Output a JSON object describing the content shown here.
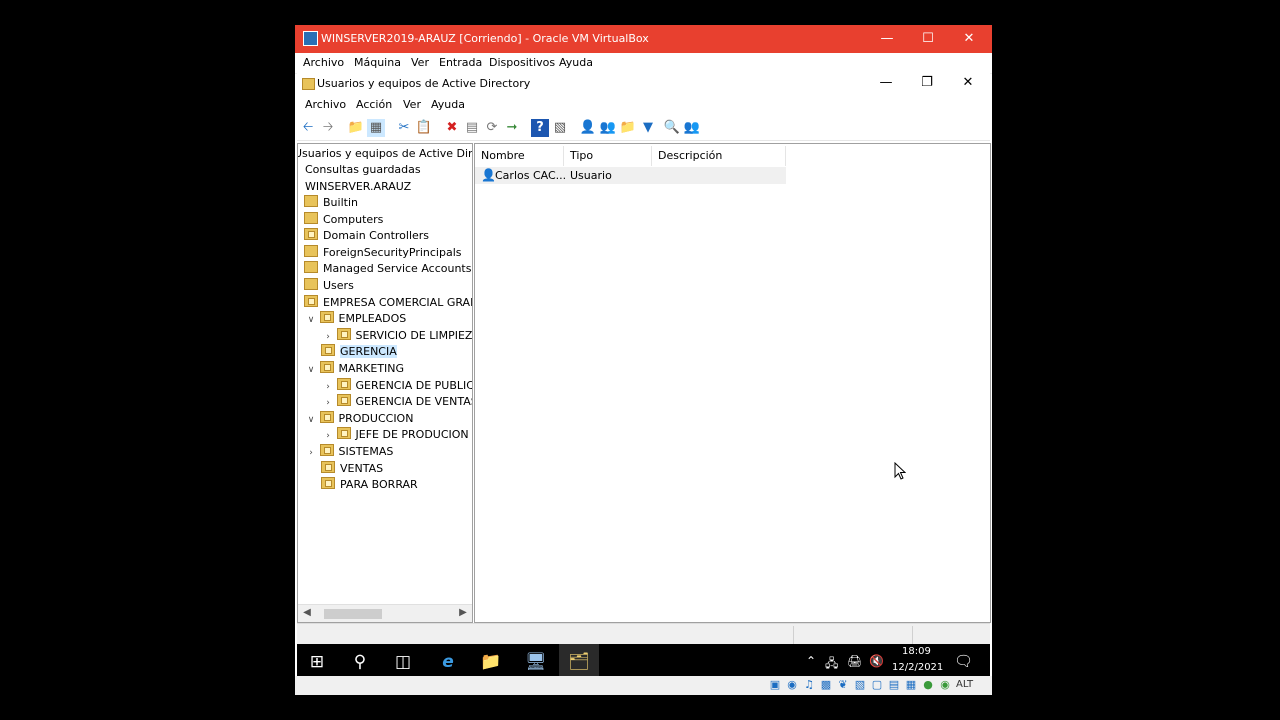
{
  "vbox": {
    "title": "WINSERVER2019-ARAUZ [Corriendo] - Oracle VM VirtualBox",
    "menu": [
      "Archivo",
      "Máquina",
      "Ver",
      "Entrada",
      "Dispositivos",
      "Ayuda"
    ],
    "status_key": "ALT"
  },
  "aduc": {
    "title": "Usuarios y equipos de Active Directory",
    "menu": [
      "Archivo",
      "Acción",
      "Ver",
      "Ayuda"
    ],
    "tree": {
      "root": "Usuarios y equipos de Active Directory",
      "saved": "Consultas guardadas",
      "domain": "WINSERVER.ARAUZ",
      "items": [
        "Builtin",
        "Computers",
        "Domain Controllers",
        "ForeignSecurityPrincipals",
        "Managed Service Accounts",
        "Users",
        "EMPRESA COMERCIAL GRAN A",
        "EMPLEADOS",
        "SERVICIO DE LIMPIEZA",
        "GERENCIA",
        "MARKETING",
        "GERENCIA DE PUBLICIDA",
        "GERENCIA DE VENTAS",
        "PRODUCCION",
        "JEFE DE PRODUCION",
        "SISTEMAS",
        "VENTAS",
        "PARA BORRAR"
      ]
    },
    "list": {
      "columns": [
        "Nombre",
        "Tipo",
        "Descripción"
      ],
      "rows": [
        {
          "name": "Carlos CAC...",
          "type": "Usuario",
          "description": ""
        }
      ]
    }
  },
  "taskbar": {
    "time": "18:09",
    "date": "12/2/2021"
  },
  "colors": {
    "vbox_titlebar": "#e8402f",
    "selection": "#cce8ff",
    "folder": "#e8c35a"
  }
}
